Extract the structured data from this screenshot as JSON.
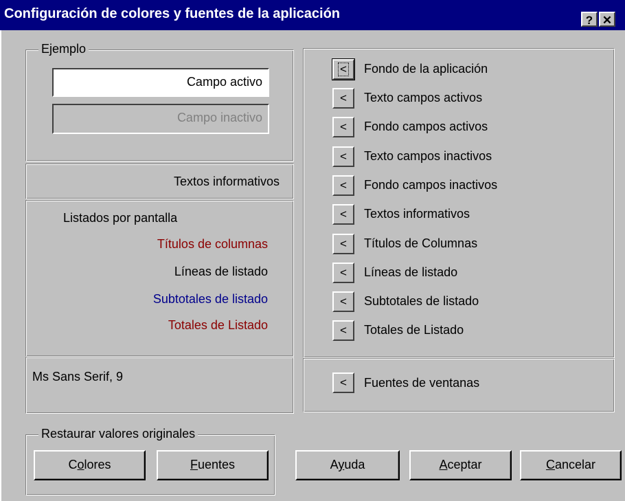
{
  "window": {
    "title": "Configuración de colores y fuentes de la aplicación",
    "help_button": "?",
    "close_button": "✕"
  },
  "sample": {
    "group_label": "Ejemplo",
    "active_field": "Campo activo",
    "inactive_field": "Campo inactivo",
    "informative_text": "Textos informativos",
    "listing_title": "Listados por pantalla",
    "column_titles": "Títulos de columnas",
    "listing_lines": "Líneas de listado",
    "subtotals": "Subtotales de listado",
    "totals": "Totales de Listado",
    "font_info": "Ms Sans Serif, 9"
  },
  "colors": {
    "column_titles": "#8b0000",
    "subtotals": "#00008b",
    "totals": "#8b0000"
  },
  "color_settings": {
    "button_glyph": "<",
    "items": [
      "Fondo de la aplicación",
      "Texto campos activos",
      "Fondo campos activos",
      "Texto campos inactivos",
      "Fondo campos inactivos",
      "Textos informativos",
      "Títulos de Columnas",
      "Líneas de listado",
      "Subtotales de listado",
      "Totales de Listado"
    ],
    "fonts_item": "Fuentes de ventanas"
  },
  "restore": {
    "group_label": "Restaurar valores originales",
    "colors_pre": "C",
    "colors_ul": "o",
    "colors_post": "lores",
    "fonts_pre": "",
    "fonts_ul": "F",
    "fonts_post": "uentes"
  },
  "actions": {
    "help_pre": "A",
    "help_ul": "y",
    "help_post": "uda",
    "accept_pre": "",
    "accept_ul": "A",
    "accept_post": "ceptar",
    "cancel_pre": "",
    "cancel_ul": "C",
    "cancel_post": "ancelar"
  }
}
